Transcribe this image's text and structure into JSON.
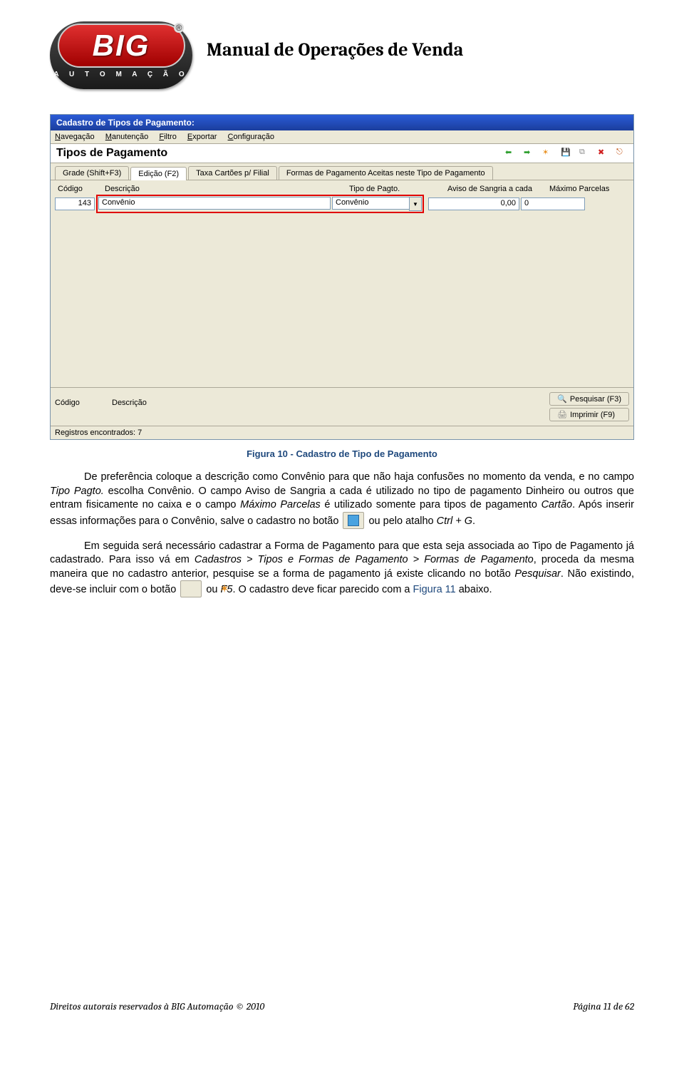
{
  "header": {
    "logo_main": "BIG",
    "logo_sub": "A U T O M A Ç Ã O",
    "reg": "®",
    "title": "Manual de Operações de Venda"
  },
  "screenshot": {
    "titlebar": "Cadastro de Tipos de Pagamento:",
    "menus": [
      "Navegação",
      "Manutenção",
      "Filtro",
      "Exportar",
      "Configuração"
    ],
    "panel_title": "Tipos de Pagamento",
    "tabs": [
      "Grade (Shift+F3)",
      "Edição (F2)",
      "Taxa Cartões p/ Filial",
      "Formas de Pagamento Aceitas neste Tipo de Pagamento"
    ],
    "columns": {
      "codigo": "Código",
      "descricao": "Descrição",
      "tipo": "Tipo de Pagto.",
      "aviso": "Aviso de Sangria a cada",
      "max": "Máximo Parcelas"
    },
    "row": {
      "codigo": "143",
      "descricao": "Convênio",
      "tipo": "Convênio",
      "aviso": "0,00",
      "max": "0"
    },
    "bottom": {
      "codigo_label": "Código",
      "descricao_label": "Descrição",
      "pesquisar": "Pesquisar (F3)",
      "imprimir": "Imprimir (F9)"
    },
    "status": "Registros encontrados: 7"
  },
  "caption": "Figura 10 - Cadastro de Tipo de Pagamento",
  "para1_a": "De preferência coloque a descrição como Convênio para que não haja confusões no momento da venda, e no campo ",
  "para1_b": "Tipo Pagto.",
  "para1_c": " escolha Convênio. O campo Aviso de Sangria a cada é utilizado no tipo de pagamento Dinheiro ou outros que entram fisicamente no caixa e o campo ",
  "para1_d": "Máximo Parcelas",
  "para1_e": " é utilizado somente para tipos de pagamento ",
  "para1_f": "Cartão",
  "para1_g": ". Após inserir essas informações para o Convênio, salve o cadastro no botão ",
  "para1_h": " ou pelo atalho ",
  "para1_i": "Ctrl + G",
  "para1_j": ".",
  "para2_a": "Em seguida será necessário cadastrar a Forma de Pagamento para que esta seja associada ao Tipo de Pagamento já cadastrado. Para isso vá em ",
  "para2_b": "Cadastros > Tipos e Formas de Pagamento > Formas de Pagamento",
  "para2_c": ", proceda da mesma maneira que no cadastro anterior, pesquise se a forma de pagamento já existe clicando no botão ",
  "para2_d": "Pesquisar",
  "para2_e": ". Não existindo, deve-se incluir com o botão ",
  "para2_f": " ou ",
  "para2_g": "F5",
  "para2_h": ". O cadastro deve ficar parecido com a ",
  "para2_i": "Figura 11",
  "para2_j": " abaixo.",
  "footer": {
    "left": "Direitos autorais reservados à BIG Automação © 2010",
    "right": "Página 11 de 62"
  }
}
